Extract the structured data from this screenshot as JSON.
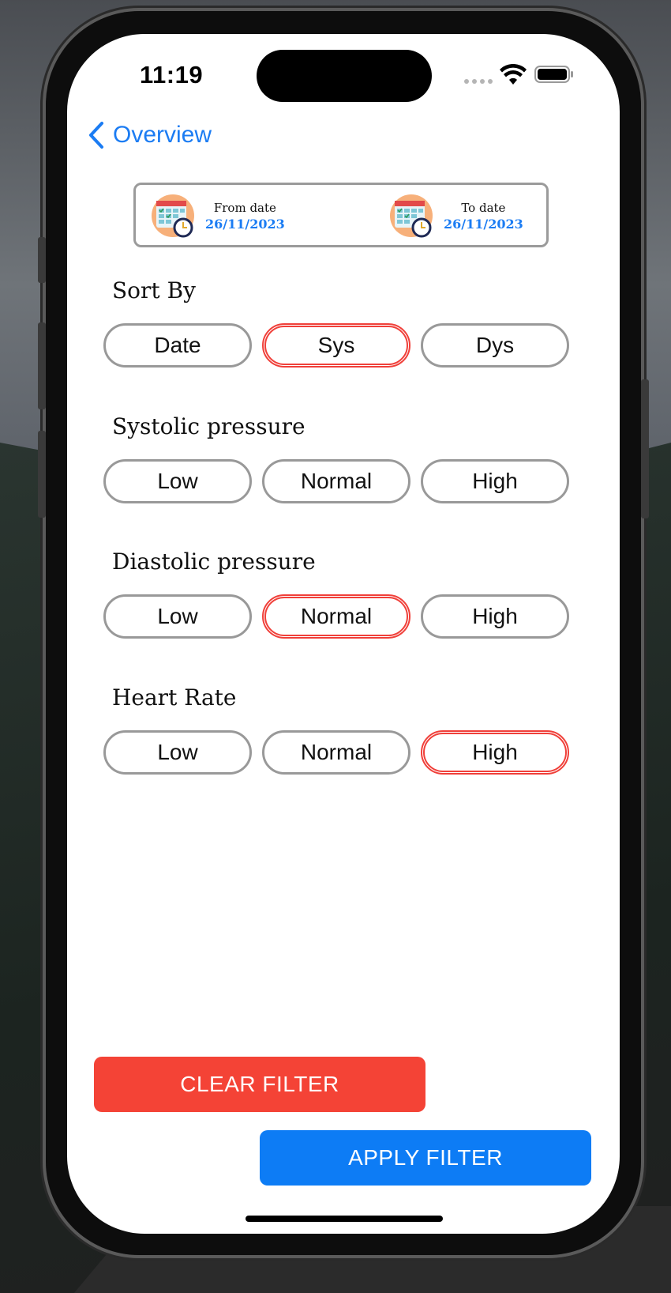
{
  "status_bar": {
    "time": "11:19"
  },
  "nav": {
    "back_label": "Overview"
  },
  "date_range": {
    "from_label": "From date",
    "from_value": "26/11/2023",
    "to_label": "To date",
    "to_value": "26/11/2023"
  },
  "sections": [
    {
      "title": "Sort By",
      "options": [
        "Date",
        "Sys",
        "Dys"
      ],
      "selected": "Sys"
    },
    {
      "title": "Systolic pressure",
      "options": [
        "Low",
        "Normal",
        "High"
      ],
      "selected": null
    },
    {
      "title": "Diastolic pressure",
      "options": [
        "Low",
        "Normal",
        "High"
      ],
      "selected": "Normal"
    },
    {
      "title": "Heart Rate",
      "options": [
        "Low",
        "Normal",
        "High"
      ],
      "selected": "High"
    }
  ],
  "buttons": {
    "clear": "CLEAR FILTER",
    "apply": "APPLY FILTER"
  },
  "colors": {
    "accent": "#1b7cf3",
    "selected_border": "#f0403a",
    "clear_button": "#f44336",
    "apply_button": "#0d7cf5"
  }
}
